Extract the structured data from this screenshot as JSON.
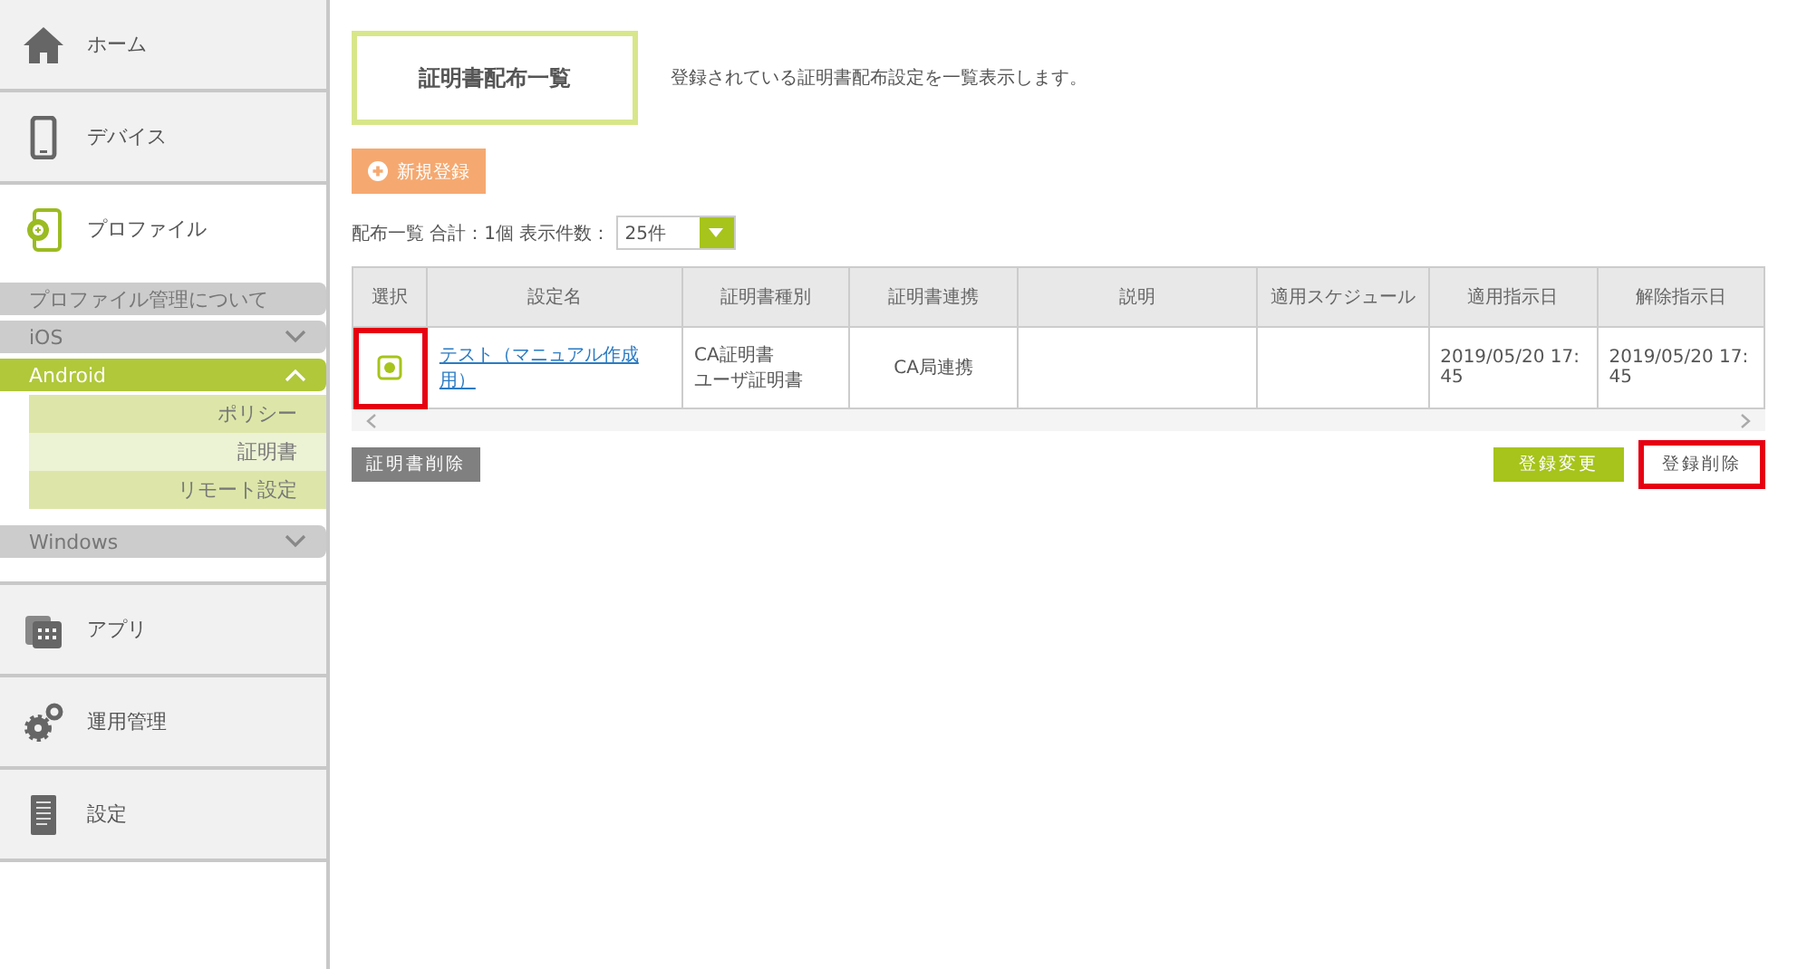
{
  "sidebar": {
    "nav_top": [
      {
        "label": "ホーム",
        "selected": false
      },
      {
        "label": "デバイス",
        "selected": false
      },
      {
        "label": "プロファイル",
        "selected": true
      }
    ],
    "sections": [
      {
        "label": "プロファイル管理について",
        "kind": "link"
      },
      {
        "label": "iOS",
        "kind": "group",
        "expanded": false
      },
      {
        "label": "Android",
        "kind": "group",
        "expanded": true,
        "children": [
          {
            "label": "ポリシー",
            "selected": false
          },
          {
            "label": "証明書",
            "selected": true
          },
          {
            "label": "リモート設定",
            "selected": false
          }
        ]
      },
      {
        "label": "Windows",
        "kind": "group",
        "expanded": false
      }
    ],
    "nav_bottom": [
      {
        "label": "アプリ",
        "selected": false
      },
      {
        "label": "運用管理",
        "selected": false
      },
      {
        "label": "設定",
        "selected": false
      }
    ]
  },
  "page": {
    "title": "証明書配布一覧",
    "description": "登録されている証明書配布設定を一覧表示します。"
  },
  "new_button": "新規登録",
  "summary": {
    "text": "配布一覧 合計：1個 表示件数：",
    "page_size": "25件"
  },
  "table": {
    "columns": [
      "選択",
      "設定名",
      "証明書種別",
      "証明書連携",
      "説明",
      "適用スケジュール",
      "適用指示日",
      "解除指示日"
    ],
    "rows": [
      {
        "selected": true,
        "highlighted": true,
        "name": "テスト（マニュアル作成用）",
        "cert_types": [
          "CA証明書",
          "ユーザ証明書"
        ],
        "link": "CA局連携",
        "description": "",
        "schedule": "",
        "apply_date": "2019/05/20 17:45",
        "release_date": "2019/05/20 17:45"
      }
    ]
  },
  "buttons": [
    {
      "label": "証明書削除",
      "kind": "grey",
      "highlighted": false
    },
    {
      "label": "登録変更",
      "kind": "green",
      "highlighted": false
    },
    {
      "label": "登録削除",
      "kind": "white",
      "highlighted": true
    }
  ]
}
